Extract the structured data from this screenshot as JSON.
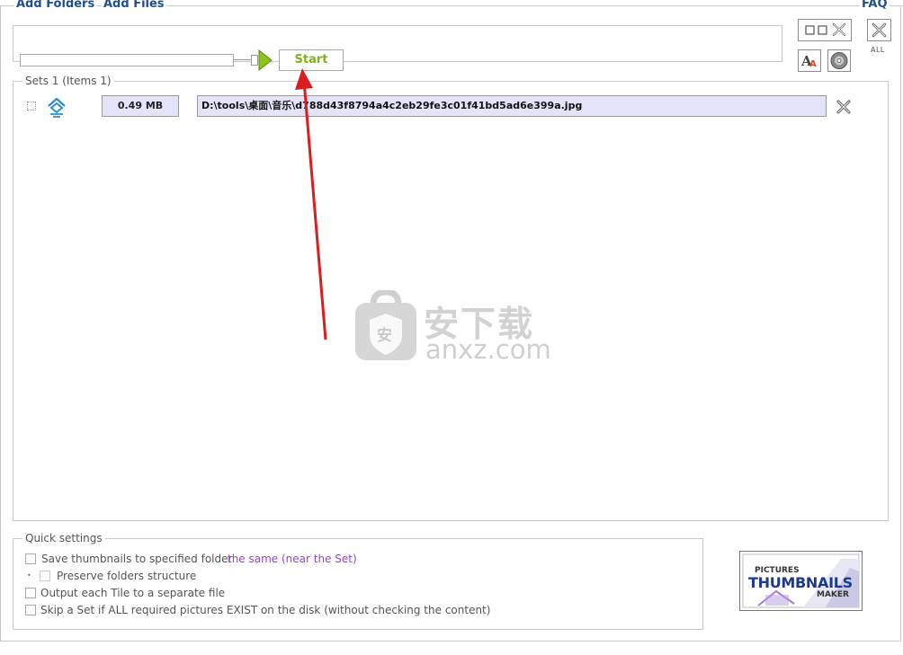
{
  "toolbar": {
    "add_folders": "Add Folders",
    "add_files": "Add Files",
    "faq": "FAQ",
    "start_label": "Start",
    "all_label": "ALL"
  },
  "sets": {
    "header": "Sets 1 (Items 1)",
    "items": [
      {
        "size": "0.49 MB",
        "path": "D:\\tools\\桌面\\音乐\\d788d43f8794a4c2eb29fe3c01f41bd5ad6e399a.jpg"
      }
    ]
  },
  "quick_settings": {
    "title": "Quick settings",
    "save_thumbnails": "Save thumbnails to specified folder",
    "save_target": "the same (near the Set)",
    "preserve_structure": "Preserve folders structure",
    "output_each_tile": "Output each Tile to a separate file",
    "skip_set": "Skip a Set if ALL required pictures EXIST on the disk (without checking the content)"
  },
  "logo": {
    "line1": "PICTURES",
    "line2": "THUMBNAILS",
    "line3": "MAKER"
  },
  "watermark": {
    "cn": "安下载",
    "en": "anxz.com",
    "shield_char": "安"
  },
  "colors": {
    "link": "#1f4f8f",
    "start_green": "#7cb518",
    "path_bg": "#e3e3fa",
    "purple": "#9b3fd6",
    "arrow_red": "#d81e1e"
  }
}
